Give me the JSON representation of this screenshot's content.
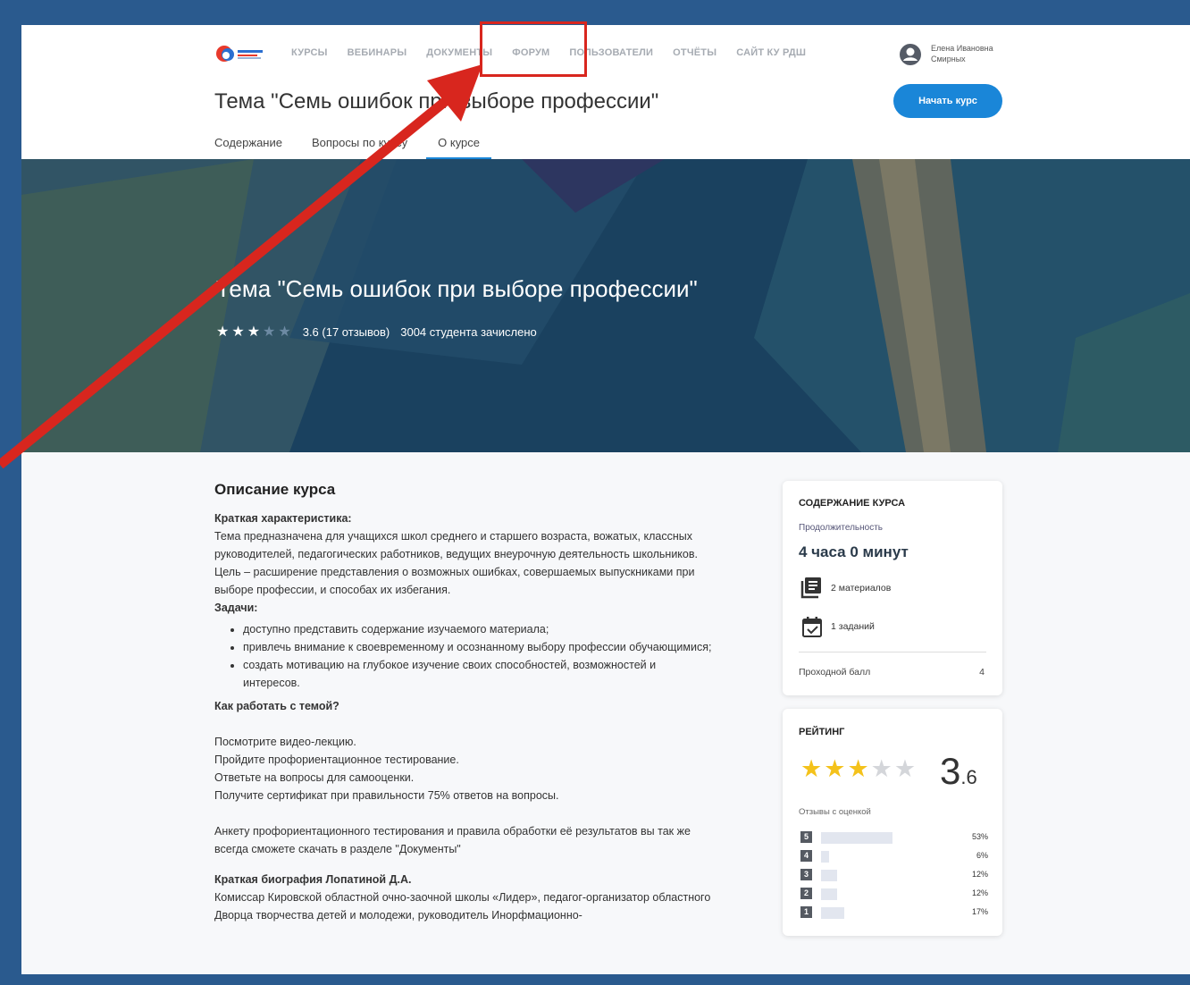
{
  "header": {
    "nav": [
      "КУРСЫ",
      "ВЕБИНАРЫ",
      "ДОКУМЕНТЫ",
      "ФОРУМ",
      "ПОЛЬЗОВАТЕЛИ",
      "ОТЧЁТЫ",
      "САЙТ КУ РДШ"
    ],
    "user_name": "Елена Ивановна Смирных",
    "course_title": "Тема \"Семь ошибок при выборе профессии\"",
    "start_button": "Начать курс",
    "tabs": [
      "Содержание",
      "Вопросы по курсу",
      "О курсе"
    ],
    "active_tab": "О курсе"
  },
  "hero": {
    "title": "Тема \"Семь ошибок при выборе профессии\"",
    "rating_text": "3.6 (17 отзывов)",
    "enrolled": "3004 студента зачислено",
    "stars_filled": 3,
    "stars_total": 5
  },
  "description": {
    "heading": "Описание курса",
    "short_label": "Краткая характеристика:",
    "short_text": "Тема предназначена для учащихся школ среднего и старшего возраста, вожатых, классных руководителей, педагогических работников, ведущих внеурочную деятельность школьников.",
    "goal_text": "Цель – расширение представления о возможных ошибках, совершаемых выпускниками при выборе профессии, и способах их избегания.",
    "tasks_label": "Задачи:",
    "tasks": [
      "доступно представить содержание изучаемого материала;",
      "привлечь внимание к своевременному и осознанному выбору профессии обучающимися;",
      "создать мотивацию на глубокое изучение своих способностей, возможностей и интересов."
    ],
    "how_label": "Как работать с темой?",
    "steps": [
      "Посмотрите видео-лекцию.",
      "Пройдите профориентационное тестирование.",
      "Ответьте на вопросы для самооценки.",
      "Получите сертификат при правильности 75% ответов на вопросы."
    ],
    "survey_text": "Анкету профориентационного тестирования и правила обработки её результатов вы так же всегда сможете скачать в разделе \"Документы\"",
    "bio_label": "Краткая биография Лопатиной Д.А.",
    "bio_text": "Комиссар Кировской областной очно-заочной школы «Лидер», педагог-организатор областного Дворца творчества детей и молодежи, руководитель Инорфмационно-"
  },
  "content_card": {
    "title": "СОДЕРЖАНИЕ КУРСА",
    "duration_label": "Продолжительность",
    "duration": "4 часа 0 минут",
    "materials": "2 материалов",
    "tasks": "1 заданий",
    "pass_label": "Проходной балл",
    "pass_value": "4"
  },
  "rating_card": {
    "title": "РЕЙТИНГ",
    "value_int": "3",
    "value_dec": ".6",
    "stars_filled": 3,
    "reviews_label": "Отзывы с оценкой",
    "histogram": [
      {
        "label": "5",
        "percent": 53,
        "text": "53%"
      },
      {
        "label": "4",
        "percent": 6,
        "text": "6%"
      },
      {
        "label": "3",
        "percent": 12,
        "text": "12%"
      },
      {
        "label": "2",
        "percent": 12,
        "text": "12%"
      },
      {
        "label": "1",
        "percent": 17,
        "text": "17%"
      }
    ]
  },
  "colors": {
    "accent": "#1a86d8",
    "frame": "#2a5a8e",
    "annotation": "#d8261e",
    "star": "#f4c21b"
  }
}
